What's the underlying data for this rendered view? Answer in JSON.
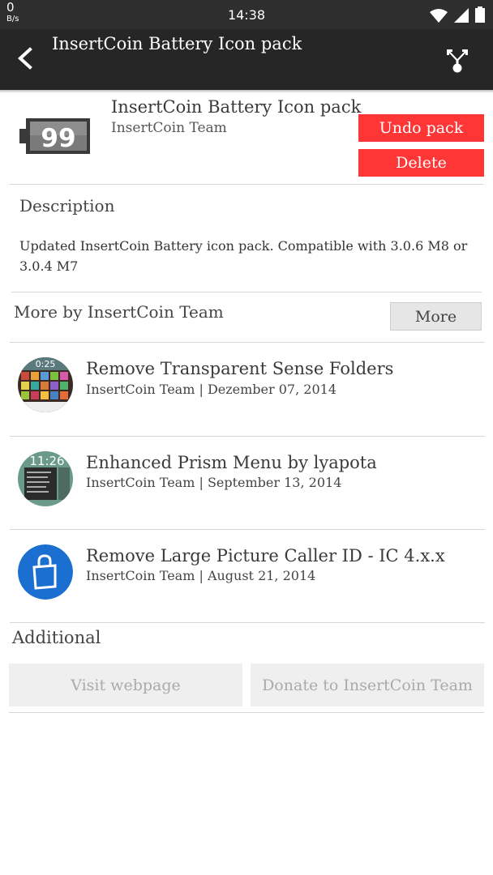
{
  "status_bar": {
    "speed_value": "0",
    "speed_unit": "B/s",
    "time": "14:38",
    "icons": [
      "wifi-icon",
      "signal-icon",
      "battery-icon"
    ]
  },
  "app_bar": {
    "title": "InsertCoin Battery Icon pack",
    "icons": [
      "back-arrow-icon",
      "share-icon"
    ]
  },
  "pack": {
    "icon_number": "99",
    "title": "InsertCoin Battery Icon pack",
    "author": "InsertCoin Team",
    "undo_label": "Undo pack",
    "delete_label": "Delete"
  },
  "description": {
    "heading": "Description",
    "text": "Updated InsertCoin Battery icon pack. Compatible with 3.0.6 M8 or 3.0.4 M7"
  },
  "more_by": {
    "heading": "More by InsertCoin Team",
    "more_label": "More",
    "items": [
      {
        "title": "Remove Transparent Sense Folders",
        "subtitle": "InsertCoin Team | Dezember 07, 2014",
        "thumb_text": "0:25"
      },
      {
        "title": "Enhanced Prism Menu by lyapota",
        "subtitle": "InsertCoin Team | September 13, 2014",
        "thumb_text": "11:26"
      },
      {
        "title": "Remove Large Picture Caller ID - IC 4.x.x",
        "subtitle": "InsertCoin Team | August 21, 2014",
        "thumb_text": ""
      }
    ]
  },
  "additional": {
    "heading": "Additional",
    "visit_label": "Visit webpage",
    "donate_label": "Donate to InsertCoin Team"
  },
  "colors": {
    "accent_red": "#ff3636",
    "app_bar": "#262626",
    "status_bar": "#2e2e2e",
    "store_blue": "#1b6fd0"
  }
}
